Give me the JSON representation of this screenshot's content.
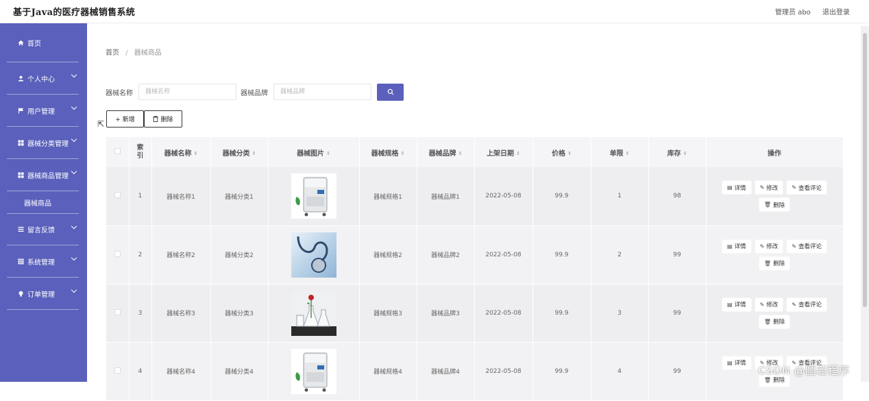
{
  "app": {
    "title": "基于Java的医疗器械销售系统",
    "user_label": "管理员 abo",
    "logout_label": "退出登录"
  },
  "sidebar": {
    "items": [
      {
        "label": "首页",
        "icon": "home-icon"
      },
      {
        "label": "个人中心",
        "icon": "user-icon"
      },
      {
        "label": "用户管理",
        "icon": "flag-icon"
      },
      {
        "label": "器械分类管理",
        "icon": "grid-icon"
      },
      {
        "label": "器械商品管理",
        "icon": "grid-icon"
      },
      {
        "label": "器械商品",
        "icon": ""
      },
      {
        "label": "留言反馈",
        "icon": "list-icon"
      },
      {
        "label": "系统管理",
        "icon": "grid-icon"
      },
      {
        "label": "订单管理",
        "icon": "bulb-icon"
      }
    ]
  },
  "breadcrumb": {
    "home": "首页",
    "separator": "/",
    "current": "器械商品"
  },
  "search": {
    "name_label": "器械名称",
    "name_placeholder": "器械名称",
    "brand_label": "器械品牌",
    "brand_placeholder": "器械品牌"
  },
  "toolbar": {
    "add_label": "+ 新增",
    "delete_label": "删除"
  },
  "table": {
    "headers": [
      "索引",
      "器械名称",
      "器械分类",
      "器械图片",
      "器械规格",
      "器械品牌",
      "上架日期",
      "价格",
      "单限",
      "库存",
      "操作"
    ],
    "rows": [
      {
        "index": "1",
        "name": "器械名称1",
        "category": "器械分类1",
        "image": "device-image",
        "spec": "器械规格1",
        "brand": "器械品牌1",
        "date": "2022-05-08",
        "price": "99.9",
        "limit": "1",
        "stock": "98"
      },
      {
        "index": "2",
        "name": "器械名称2",
        "category": "器械分类2",
        "image": "stethoscope-image",
        "spec": "器械规格2",
        "brand": "器械品牌2",
        "date": "2022-05-08",
        "price": "99.9",
        "limit": "2",
        "stock": "99"
      },
      {
        "index": "3",
        "name": "器械名称3",
        "category": "器械分类3",
        "image": "lab-glassware-image",
        "spec": "器械规格3",
        "brand": "器械品牌3",
        "date": "2022-05-08",
        "price": "99.9",
        "limit": "3",
        "stock": "99"
      },
      {
        "index": "4",
        "name": "器械名称4",
        "category": "器械分类4",
        "image": "device-image",
        "spec": "器械规格4",
        "brand": "器械品牌4",
        "date": "2022-05-08",
        "price": "99.9",
        "limit": "4",
        "stock": "99"
      }
    ],
    "ops": {
      "detail": "详情",
      "edit": "修改",
      "comments": "查看评论",
      "delete": "删除"
    }
  },
  "watermark": "CSDN @圆若程序",
  "colors": {
    "sidebar_bg": "#5a60bb",
    "accent": "#5a60bb",
    "header_bg": "#f5f5f8"
  }
}
